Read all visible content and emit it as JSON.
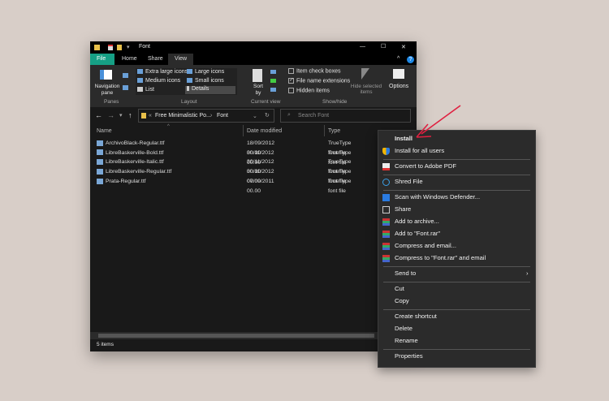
{
  "window": {
    "title": "Font",
    "minimize": "—",
    "maximize": "☐",
    "close": "✕"
  },
  "tabs": [
    {
      "label": "File"
    },
    {
      "label": "Home"
    },
    {
      "label": "Share"
    },
    {
      "label": "View"
    }
  ],
  "ribbon": {
    "panes": {
      "nav": "Navigation pane",
      "group": "Panes"
    },
    "layout": {
      "items": [
        "Extra large icons",
        "Large icons",
        "Medium icons",
        "Small icons",
        "List",
        "Details"
      ],
      "group": "Layout"
    },
    "current_view": {
      "sort": "Sort by",
      "group": "Current view"
    },
    "show_hide": {
      "item_check_boxes": "Item check boxes",
      "file_name_extensions": "File name extensions",
      "hidden_items": "Hidden items",
      "hide_selected": "Hide selected items",
      "group": "Show/hide"
    },
    "options": "Options"
  },
  "address": {
    "path": [
      "Free Minimalistic Po...",
      "Font"
    ],
    "search_placeholder": "Search Font"
  },
  "columns": [
    "Name",
    "Date modified",
    "Type"
  ],
  "files": [
    {
      "name": "ArchivoBlack-Regular.ttf",
      "date": "18/09/2012 00.00",
      "type": "TrueType font file"
    },
    {
      "name": "LibreBaskerville-Bold.ttf",
      "date": "30/11/2012 00.00",
      "type": "TrueType font file"
    },
    {
      "name": "LibreBaskerville-Italic.ttf",
      "date": "30/11/2012 00.00",
      "type": "TrueType font file"
    },
    {
      "name": "LibreBaskerville-Regular.ttf",
      "date": "30/11/2012 00.00",
      "type": "TrueType font file"
    },
    {
      "name": "Prata-Regular.ttf",
      "date": "07/09/2011 00.00",
      "type": "TrueType font file"
    }
  ],
  "status": "5 items",
  "context_menu": [
    {
      "label": "Install",
      "bold": true
    },
    {
      "label": "Install for all users",
      "icon": "shield-icon"
    },
    {
      "sep": true
    },
    {
      "label": "Convert to Adobe PDF",
      "icon": "pdf-icon"
    },
    {
      "sep": true
    },
    {
      "label": "Shred File",
      "icon": "shred-icon"
    },
    {
      "sep": true
    },
    {
      "label": "Scan with Windows Defender...",
      "icon": "defender-icon"
    },
    {
      "label": "Share",
      "icon": "share-icon"
    },
    {
      "label": "Add to archive...",
      "icon": "winrar-icon"
    },
    {
      "label": "Add to \"Font.rar\"",
      "icon": "winrar-icon"
    },
    {
      "label": "Compress and email...",
      "icon": "winrar-icon"
    },
    {
      "label": "Compress to \"Font.rar\" and email",
      "icon": "winrar-icon"
    },
    {
      "sep": true
    },
    {
      "label": "Send to",
      "submenu": true
    },
    {
      "sep": true
    },
    {
      "label": "Cut"
    },
    {
      "label": "Copy"
    },
    {
      "sep": true
    },
    {
      "label": "Create shortcut"
    },
    {
      "label": "Delete"
    },
    {
      "label": "Rename"
    },
    {
      "sep": true
    },
    {
      "label": "Properties"
    }
  ],
  "colors": {
    "file_tab": "#16a085",
    "arrow": "#e02040",
    "background": "#d8cec8"
  }
}
